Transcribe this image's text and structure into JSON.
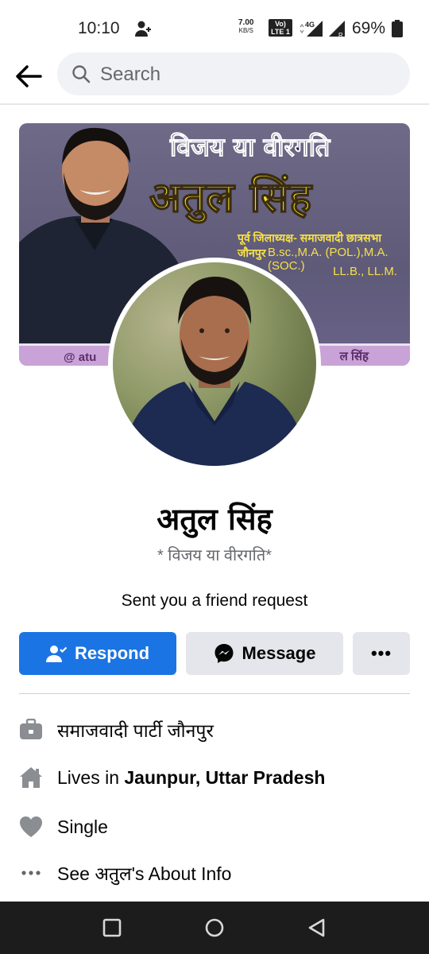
{
  "status_bar": {
    "time": "10:10",
    "net_rate_value": "7.00",
    "net_rate_unit": "KB/S",
    "volte_line1": "Vo)",
    "volte_line2": "LTE 1",
    "network": "4G",
    "battery_percent": "69%"
  },
  "search": {
    "placeholder": "Search"
  },
  "cover": {
    "title": "विजय या वीरगति",
    "name": "अतुल सिंह",
    "post": "पूर्व जिलाध्यक्ष- समाजवादी छात्रसभा जौनपुर",
    "degrees_line1": "B.sc.,M.A. (POL.),M.A.(SOC.)",
    "degrees_line2": "LL.B., LL.M.",
    "strip_left": "@ atu",
    "strip_right": "ल सिंह"
  },
  "profile": {
    "name": "अतुल सिंह",
    "tagline": "* विजय या वीरगति*",
    "friend_request_text": "Sent you a friend request"
  },
  "actions": {
    "respond_label": "Respond",
    "message_label": "Message",
    "more_label": "•••"
  },
  "info": {
    "work": "समाजवादी पार्टी जौनपुर",
    "lives_prefix": "Lives in ",
    "lives_place": "Jaunpur, Uttar Pradesh",
    "relationship": "Single",
    "about_link": "See अतुल's About Info"
  },
  "colors": {
    "primary_blue": "#1b74e4",
    "secondary_button": "#e4e6eb",
    "secondary_text": "#65676b",
    "navbar": "#1c1c1c"
  }
}
